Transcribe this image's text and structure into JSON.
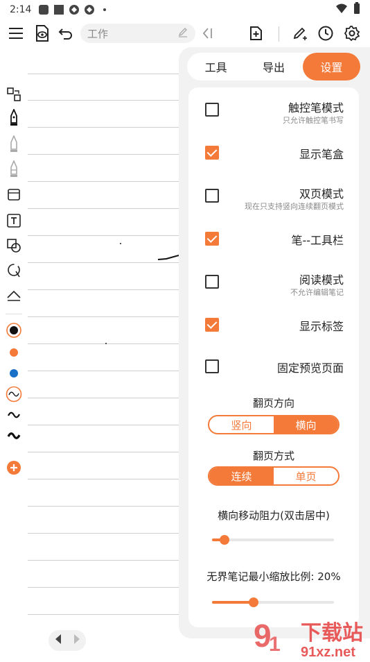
{
  "status_bar": {
    "time": "2:14"
  },
  "toolbar": {
    "title_placeholder": "工作"
  },
  "panel": {
    "tabs": [
      {
        "label": "工具",
        "active": false
      },
      {
        "label": "导出",
        "active": false
      },
      {
        "label": "设置",
        "active": true
      }
    ],
    "options": [
      {
        "label": "触控笔模式",
        "sub": "只允许触控笔书写",
        "checked": false
      },
      {
        "label": "显示笔盒",
        "sub": "",
        "checked": true
      },
      {
        "label": "双页模式",
        "sub": "现在只支持竖向连续翻页模式",
        "checked": false
      },
      {
        "label": "笔--工具栏",
        "sub": "",
        "checked": true
      },
      {
        "label": "阅读模式",
        "sub": "不允许编辑笔记",
        "checked": false
      },
      {
        "label": "显示标签",
        "sub": "",
        "checked": true
      },
      {
        "label": "固定预览页面",
        "sub": "",
        "checked": false
      }
    ],
    "page_direction": {
      "title": "翻页方向",
      "options": [
        "竖向",
        "横向"
      ],
      "selected": "横向"
    },
    "page_mode": {
      "title": "翻页方式",
      "options": [
        "连续",
        "单页"
      ],
      "selected": "连续"
    },
    "resistance": {
      "title": "横向移动阻力(双击居中)",
      "value": 0.1
    },
    "zoom": {
      "title": "无界笔记最小缩放比例: 20%",
      "value": 0.34
    }
  },
  "watermark": {
    "big": "下载站",
    "small": "91xz.net"
  },
  "colors": {
    "accent": "#f47a3a",
    "blue": "#1a6fc7",
    "black": "#111111"
  }
}
